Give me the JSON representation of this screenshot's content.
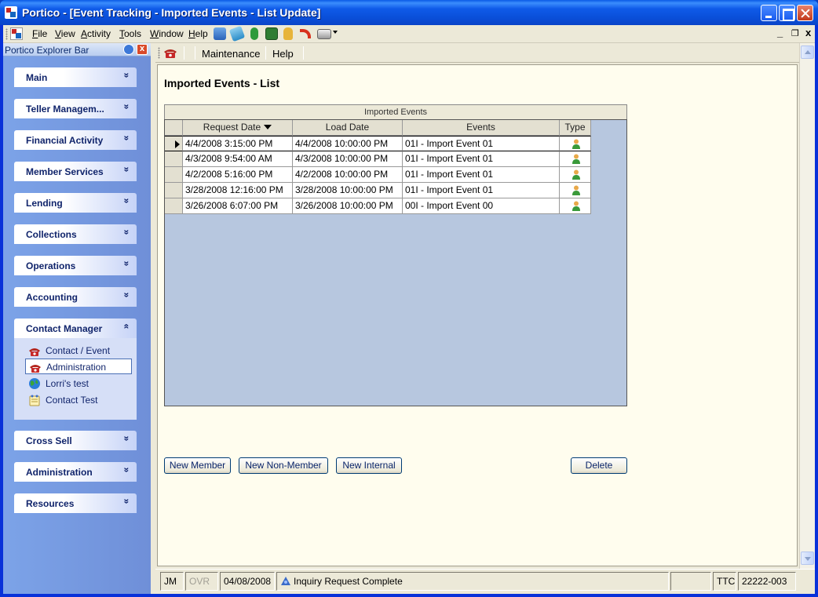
{
  "window": {
    "title": "Portico - [Event Tracking - Imported Events - List Update]"
  },
  "menubar": {
    "items": [
      "File",
      "View",
      "Activity",
      "Tools",
      "Window",
      "Help"
    ],
    "mdi_min": "_",
    "mdi_restore": "Έ",
    "mdi_close": "x"
  },
  "explorer": {
    "title": "Portico Explorer Bar",
    "close": "x",
    "groups": [
      {
        "label": "Main",
        "chevron": "»"
      },
      {
        "label": "Teller Managem...",
        "chevron": "»"
      },
      {
        "label": "Financial Activity",
        "chevron": "»"
      },
      {
        "label": "Member Services",
        "chevron": "»"
      },
      {
        "label": "Lending",
        "chevron": "»"
      },
      {
        "label": "Collections",
        "chevron": "»"
      },
      {
        "label": "Operations",
        "chevron": "»"
      },
      {
        "label": "Accounting",
        "chevron": "»"
      },
      {
        "label": "Contact Manager",
        "chevron": "«"
      },
      {
        "label": "Cross Sell",
        "chevron": "»"
      },
      {
        "label": "Administration",
        "chevron": "»"
      },
      {
        "label": "Resources",
        "chevron": "»"
      }
    ],
    "contact_manager_tasks": [
      {
        "label": "Contact / Event",
        "icon": "phone-icon"
      },
      {
        "label": "Administration",
        "icon": "phone-icon"
      },
      {
        "label": "Lorri's test",
        "icon": "globe-icon"
      },
      {
        "label": "Contact Test",
        "icon": "notepad-icon"
      }
    ]
  },
  "doc_toolbar": {
    "maintenance": "Maintenance",
    "help": "Help"
  },
  "page": {
    "title": "Imported Events - List"
  },
  "grid": {
    "caption": "Imported Events",
    "columns": [
      "Request Date",
      "Load Date",
      "Events",
      "Type"
    ],
    "rows": [
      {
        "request_date": "4/4/2008 3:15:00 PM",
        "load_date": "4/4/2008 10:00:00 PM",
        "event": "01I - Import Event 01"
      },
      {
        "request_date": "4/3/2008 9:54:00 AM",
        "load_date": "4/3/2008 10:00:00 PM",
        "event": "01I - Import Event 01"
      },
      {
        "request_date": "4/2/2008 5:16:00 PM",
        "load_date": "4/2/2008 10:00:00 PM",
        "event": "01I - Import Event 01"
      },
      {
        "request_date": "3/28/2008 12:16:00 PM",
        "load_date": "3/28/2008 10:00:00 PM",
        "event": "01I - Import Event 01"
      },
      {
        "request_date": "3/26/2008 6:07:00 PM",
        "load_date": "3/26/2008 10:00:00 PM",
        "event": "00I - Import Event 00"
      }
    ]
  },
  "buttons": {
    "new_member": "New Member",
    "new_non_member": "New Non-Member",
    "new_internal": "New Internal",
    "delete": "Delete"
  },
  "statusbar": {
    "user": "JM",
    "ovr": "OVR",
    "date": "04/08/2008",
    "message": "Inquiry Request Complete",
    "ttc": "TTC",
    "code": "22222-003"
  },
  "colors": {
    "title_bar": "#0a4fd9",
    "explorer_bg": "#7ba2e7",
    "doc_bg": "#fffdee",
    "grid_bg": "#b7c7df"
  }
}
